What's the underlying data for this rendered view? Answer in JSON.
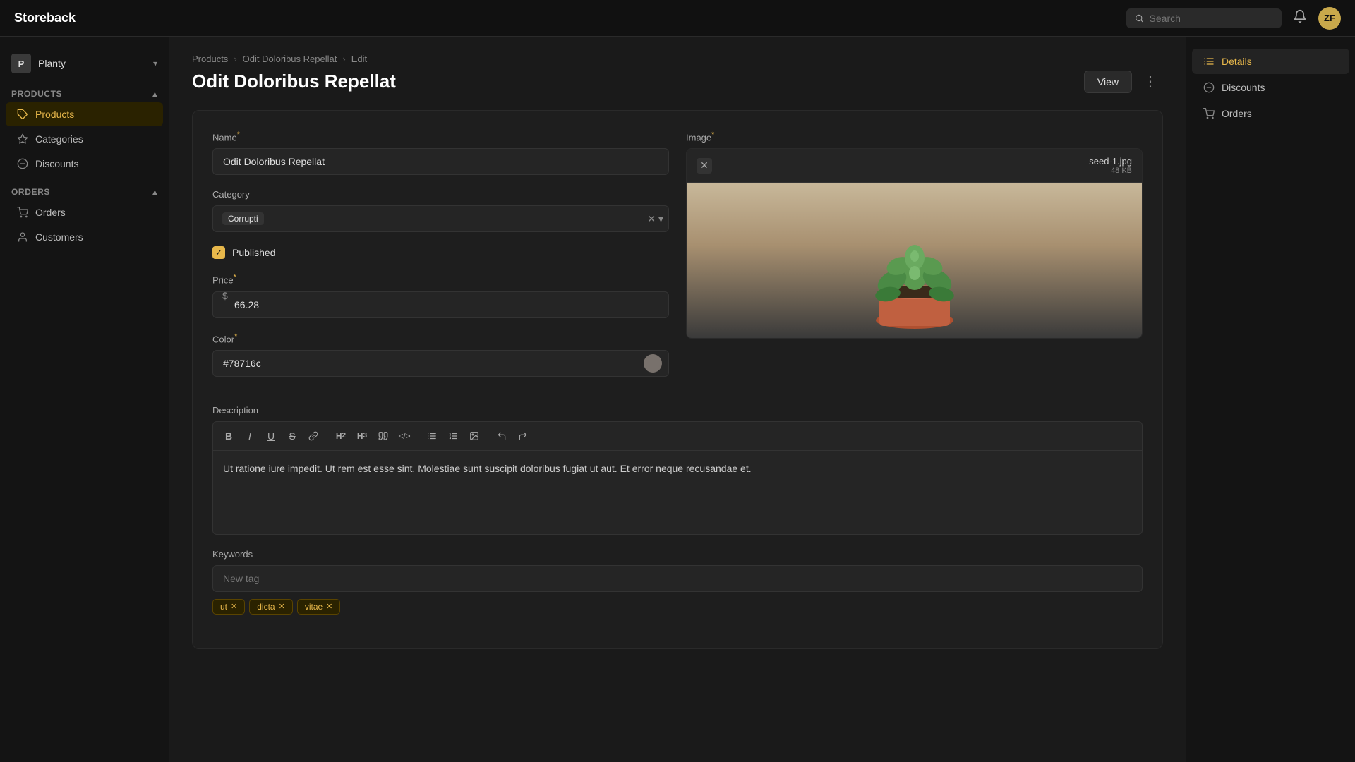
{
  "app": {
    "brand": "Storeback",
    "user_initials": "ZF"
  },
  "topnav": {
    "search_placeholder": "Search"
  },
  "sidebar": {
    "workspace": "Planty",
    "workspace_initial": "P",
    "sections": [
      {
        "label": "Products",
        "items": [
          {
            "id": "products",
            "label": "Products",
            "icon": "🏷",
            "active": true
          },
          {
            "id": "categories",
            "label": "Categories",
            "icon": "◇"
          },
          {
            "id": "discounts",
            "label": "Discounts",
            "icon": "◎"
          }
        ]
      },
      {
        "label": "Orders",
        "items": [
          {
            "id": "orders",
            "label": "Orders",
            "icon": "🛒"
          },
          {
            "id": "customers",
            "label": "Customers",
            "icon": "👤"
          }
        ]
      }
    ]
  },
  "breadcrumb": {
    "items": [
      "Products",
      "Odit Doloribus Repellat",
      "Edit"
    ]
  },
  "page": {
    "title": "Odit Doloribus Repellat",
    "view_label": "View"
  },
  "form": {
    "name_label": "Name",
    "name_required": true,
    "name_value": "Odit Doloribus Repellat",
    "category_label": "Category",
    "category_value": "Corrupti",
    "published_label": "Published",
    "published": true,
    "price_label": "Price",
    "price_required": true,
    "price_prefix": "$",
    "price_value": "66.28",
    "color_label": "Color",
    "color_required": true,
    "color_value": "#78716c",
    "color_hex_display": "#78716c",
    "description_label": "Description",
    "description_value": "Ut ratione iure impedit. Ut rem est esse sint. Molestiae sunt suscipit doloribus fugiat ut aut. Et error neque recusandae et.",
    "keywords_label": "Keywords",
    "keywords_placeholder": "New tag",
    "tags": [
      "ut",
      "dicta",
      "vitae"
    ]
  },
  "image": {
    "label": "Image",
    "required": true,
    "filename": "seed-1.jpg",
    "filesize": "48 KB"
  },
  "toolbar": {
    "bold": "B",
    "italic": "I",
    "underline": "U",
    "strikethrough": "S",
    "link": "🔗",
    "h2": "H₂",
    "h3": "H₃",
    "quote": "❝",
    "code": "<>",
    "bullet_list": "≡",
    "ordered_list": "1≡",
    "image": "🖼",
    "undo": "↩",
    "redo": "↪"
  },
  "right_panel": {
    "items": [
      {
        "id": "details",
        "label": "Details",
        "icon": "list",
        "active": true
      },
      {
        "id": "discounts",
        "label": "Discounts",
        "icon": "circle"
      },
      {
        "id": "orders",
        "label": "Orders",
        "icon": "cart"
      }
    ]
  }
}
